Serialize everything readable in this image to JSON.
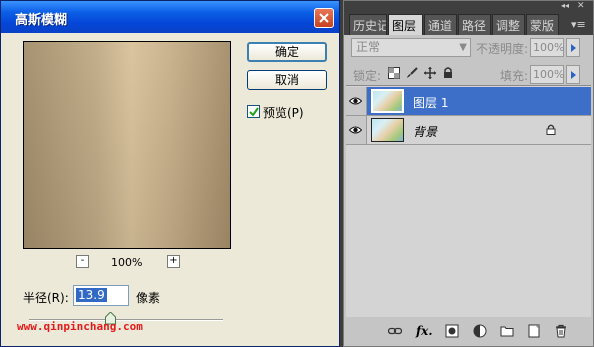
{
  "dialog": {
    "title": "高斯模糊",
    "ok_label": "确定",
    "cancel_label": "取消",
    "preview_label": "预览(P)",
    "preview_checked": true,
    "zoom_out": "-",
    "zoom_in": "+",
    "zoom_level": "100%",
    "radius_label": "半径(R):",
    "radius_value": "13.9",
    "radius_unit": "像素"
  },
  "watermark": "www.qinpinchang.com",
  "panel": {
    "tabs": [
      {
        "label": "历史记"
      },
      {
        "label": "图层"
      },
      {
        "label": "通道"
      },
      {
        "label": "路径"
      },
      {
        "label": "调整"
      },
      {
        "label": "蒙版"
      }
    ],
    "active_tab": "图层",
    "blend_mode": "正常",
    "opacity_label": "不透明度:",
    "opacity_value": "100%",
    "lock_label": "锁定:",
    "fill_label": "填充:",
    "fill_value": "100%",
    "layers": [
      {
        "name": "图层 1",
        "selected": true,
        "visible": true
      },
      {
        "name": "背景",
        "selected": false,
        "visible": true,
        "locked": true
      }
    ]
  },
  "colors": {
    "title_bar": "#0b5fe6",
    "selected_layer": "#3d6fc8",
    "watermark": "#e41a1a"
  }
}
